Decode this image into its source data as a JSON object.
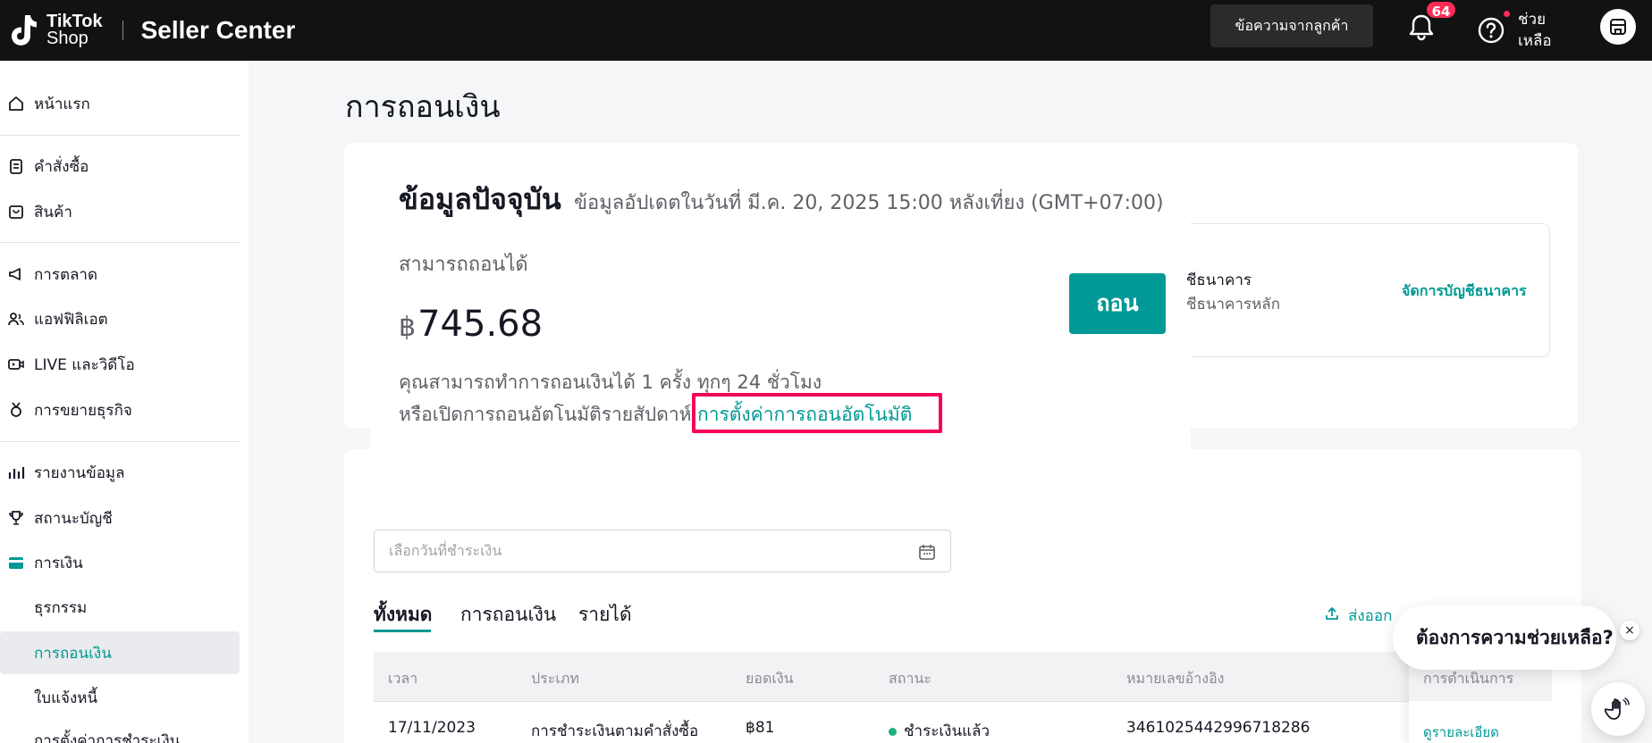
{
  "topbar": {
    "logo_line1": "TikTok",
    "logo_line2": "Shop",
    "brand": "Seller Center",
    "messages_button": "ข้อความจากลูกค้า",
    "notification_count": "64",
    "help_label": "ช่วยเหลือ"
  },
  "sidebar": {
    "home": "หน้าแรก",
    "orders": "คำสั่งซื้อ",
    "products": "สินค้า",
    "marketing": "การตลาด",
    "affiliate": "แอฟฟิลิเอต",
    "live_video": "LIVE และวิดีโอ",
    "growth": "การขยายธุรกิจ",
    "reports": "รายงานข้อมูล",
    "account_health": "สถานะบัญชี",
    "finance": "การเงิน",
    "finance_sub": {
      "transactions": "ธุรกรรม",
      "withdrawals": "การถอนเงิน",
      "invoices": "ใบแจ้งหนี้",
      "payment_settings": "การตั้งค่าการชำระเงิน"
    }
  },
  "page": {
    "title": "การถอนเงิน"
  },
  "current": {
    "title": "ข้อมูลปัจจุบัน",
    "updated": "ข้อมูลอัปเดตในวันที่ มี.ค. 20, 2025 15:00 หลังเที่ยง (GMT+07:00)",
    "available_label": "สามารถถอนได้",
    "currency_symbol": "฿",
    "amount": "745.68",
    "note_line1": "คุณสามารถทำการถอนเงินได้ 1 ครั้ง ทุกๆ 24 ชั่วโมง",
    "note_line2": "หรือเปิดการถอนอัตโนมัติรายสัปดาห์",
    "auto_link": "การตั้งค่าการถอนอัตโนมัติ",
    "withdraw_button": "ถอน"
  },
  "bank": {
    "title": "บัญชีธนาคาร",
    "subtitle": "บัญชีธนาคารหลัก",
    "manage_link": "จัดการบัญชีธนาคาร"
  },
  "filters": {
    "date_placeholder": "เลือกวันที่ชำระเงิน"
  },
  "tabs": {
    "all": "ทั้งหมด",
    "withdrawals": "การถอนเงิน",
    "income": "รายได้",
    "export": "ส่งออก"
  },
  "table": {
    "headers": {
      "time": "เวลา",
      "type": "ประเภท",
      "amount": "ยอดเงิน",
      "status": "สถานะ",
      "reference": "หมายเลขอ้างอิง",
      "actions": "การดำเนินการ"
    },
    "rows": [
      {
        "time": "17/11/2023",
        "type": "การชำระเงินตามคำสั่งซื้อ",
        "amount": "฿81",
        "status": "ชำระเงินแล้ว",
        "reference": "3461025442996718286",
        "action": "ดูรายละเอียด"
      }
    ]
  },
  "help_bubble": {
    "text": "ต้องการความช่วยเหลือ?",
    "close": "×"
  },
  "colors": {
    "accent": "#009995",
    "highlight": "#f5005a",
    "badge": "#fe2c55"
  }
}
